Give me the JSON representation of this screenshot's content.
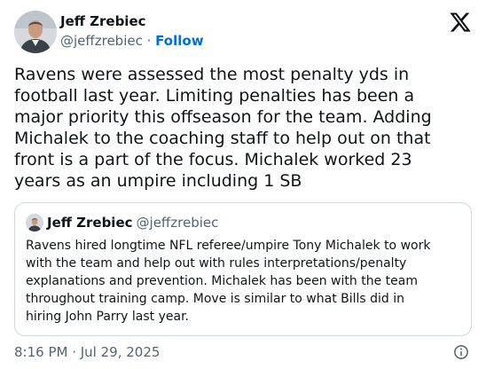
{
  "author": {
    "name": "Jeff Zrebiec",
    "handle": "@jeffzrebiec",
    "separator": " · ",
    "follow_label": "Follow"
  },
  "brand_logo": "x-logo-icon",
  "tweet": {
    "text": "Ravens were assessed the most penalty yds in\nfootball last year. Limiting penalties has been a\nmajor priority this offseason for the team. Adding\nMichalek to the coaching staff to help out on that\nfront is a part of the focus. Michalek worked 23\nyears as an umpire including 1 SB"
  },
  "quoted_tweet": {
    "name": "Jeff Zrebiec",
    "handle": "@jeffzrebiec",
    "text": "Ravens hired longtime NFL referee/umpire Tony Michalek to work\nwith the team and help out with rules interpretations/penalty\nexplanations and prevention. Michalek has been with the team\nthroughout training camp. Move is similar to what Bills did in\nhiring John Parry last year."
  },
  "footer": {
    "timestamp": "8:16 PM · Jul 29, 2025",
    "info_icon": "info-icon"
  },
  "colors": {
    "text": "#0f1419",
    "secondary": "#536471",
    "link": "#006fd6",
    "border": "#cfd9de"
  }
}
